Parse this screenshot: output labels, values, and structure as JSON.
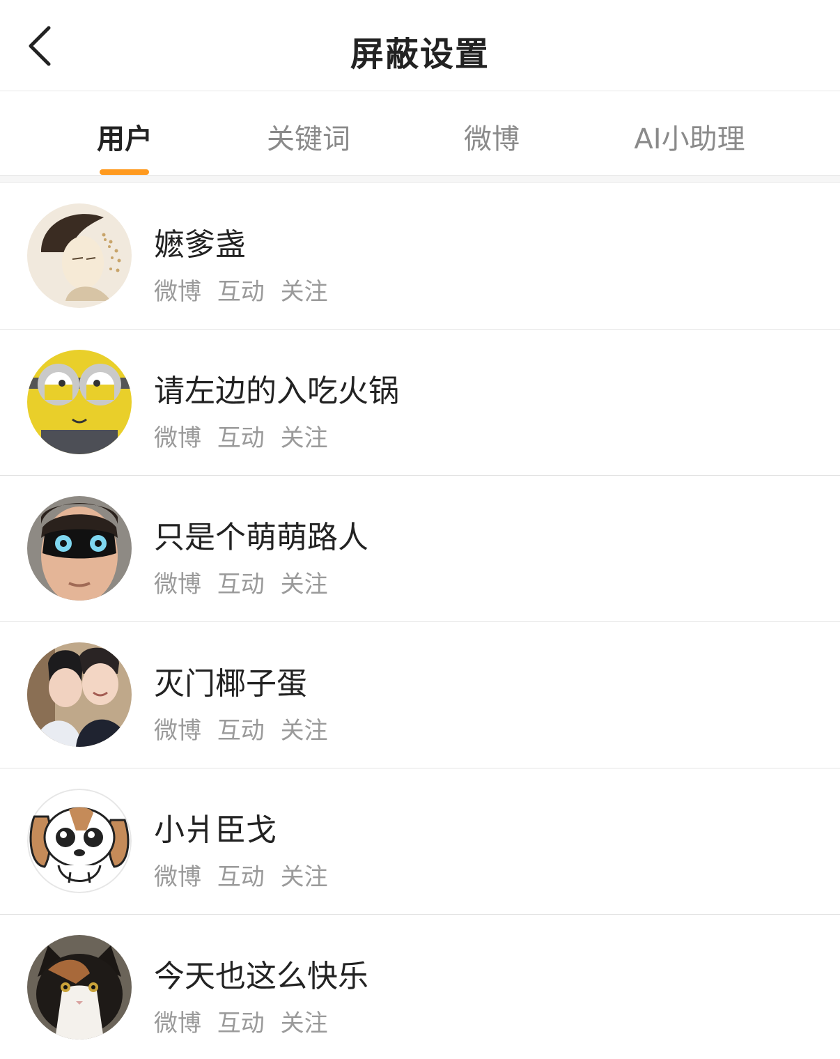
{
  "header": {
    "title": "屏蔽设置",
    "back_icon": "chevron-left-icon"
  },
  "tabs": [
    {
      "label": "用户",
      "active": true
    },
    {
      "label": "关键词",
      "active": false
    },
    {
      "label": "微博",
      "active": false
    },
    {
      "label": "AI小助理",
      "active": false
    }
  ],
  "accent_color": "#ff9a1f",
  "users": [
    {
      "name": "嬷爹盏",
      "avatar": "illustrated-woman-avatar",
      "tags": [
        "微博",
        "互动",
        "关注"
      ]
    },
    {
      "name": "请左边的入吃火锅",
      "avatar": "minion-avatar",
      "tags": [
        "微博",
        "互动",
        "关注"
      ]
    },
    {
      "name": "只是个萌萌路人",
      "avatar": "masked-man-avatar",
      "tags": [
        "微博",
        "互动",
        "关注"
      ]
    },
    {
      "name": "灭门椰子蛋",
      "avatar": "two-men-avatar",
      "tags": [
        "微博",
        "互动",
        "关注"
      ]
    },
    {
      "name": "小爿臣戈",
      "avatar": "cartoon-dog-avatar",
      "tags": [
        "微博",
        "互动",
        "关注"
      ]
    },
    {
      "name": "今天也这么快乐",
      "avatar": "calico-cat-avatar",
      "tags": [
        "微博",
        "互动",
        "关注"
      ]
    }
  ]
}
